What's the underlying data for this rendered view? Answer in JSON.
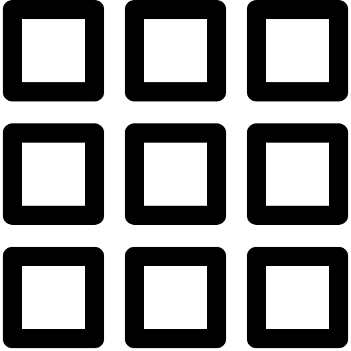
{
  "icon": {
    "name": "grid-view-icon",
    "rows": 3,
    "columns": 3,
    "color": "#000000",
    "background": "#ffffff"
  }
}
